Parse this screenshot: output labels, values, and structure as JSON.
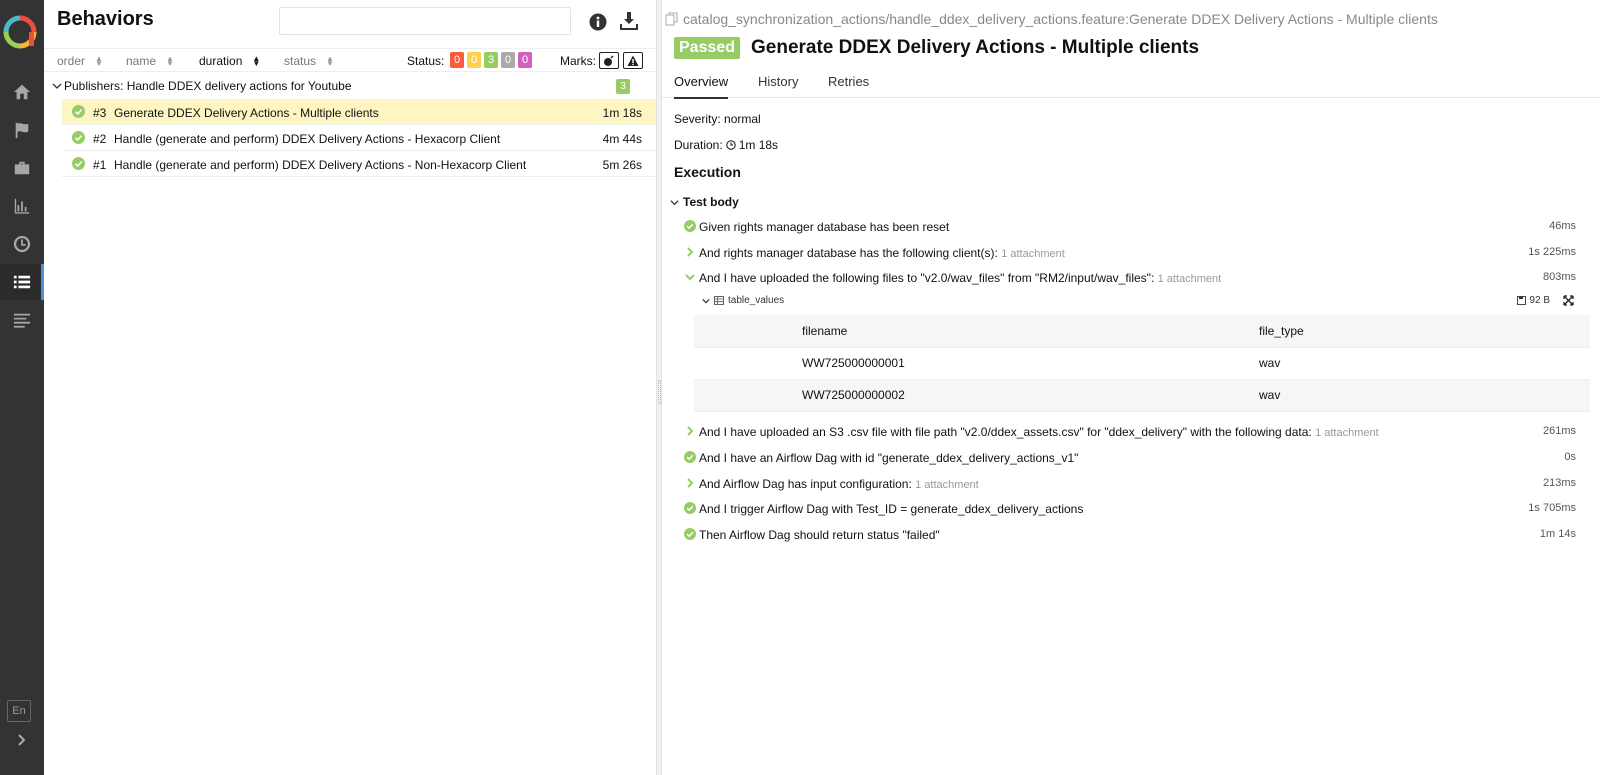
{
  "sidebar": {
    "language": "En",
    "items": [
      {
        "name": "home-icon"
      },
      {
        "name": "flag-icon"
      },
      {
        "name": "briefcase-icon"
      },
      {
        "name": "bar-chart-icon"
      },
      {
        "name": "clock-icon"
      },
      {
        "name": "list-icon",
        "active": true
      },
      {
        "name": "timeline-icon"
      }
    ]
  },
  "left": {
    "title": "Behaviors",
    "search": {
      "value": "",
      "placeholder": ""
    },
    "sort": {
      "order": "order",
      "name": "name",
      "duration": "duration",
      "status": "status"
    },
    "status_label": "Status:",
    "status_counts": [
      {
        "value": "0",
        "color": "#fd5a3e"
      },
      {
        "value": "0",
        "color": "#ffd050"
      },
      {
        "value": "3",
        "color": "#97cc64"
      },
      {
        "value": "0",
        "color": "#aaaaaa"
      },
      {
        "value": "0",
        "color": "#d35ebe"
      }
    ],
    "marks_label": "Marks:",
    "group": {
      "label": "Publishers: Handle DDEX delivery actions for Youtube",
      "count": "3"
    },
    "tests": [
      {
        "num": "#3",
        "name": "Generate DDEX Delivery Actions - Multiple clients",
        "duration": "1m 18s",
        "selected": true
      },
      {
        "num": "#2",
        "name": "Handle (generate and perform) DDEX Delivery Actions - Hexacorp Client",
        "duration": "4m 44s"
      },
      {
        "num": "#1",
        "name": "Handle (generate and perform) DDEX Delivery Actions - Non-Hexacorp Client",
        "duration": "5m 26s"
      }
    ]
  },
  "right": {
    "breadcrumb": "catalog_synchronization_actions/handle_ddex_delivery_actions.feature:Generate DDEX Delivery Actions - Multiple clients",
    "status": "Passed",
    "title": "Generate DDEX Delivery Actions - Multiple clients",
    "tabs": [
      "Overview",
      "History",
      "Retries"
    ],
    "severity": "Severity: normal",
    "duration_label": "Duration:",
    "duration_value": "1m 18s",
    "execution_title": "Execution",
    "test_body": "Test body",
    "steps": [
      {
        "text": "Given rights manager database has been reset",
        "attachment": "",
        "duration": "46ms"
      },
      {
        "text": "And rights manager database has the following client(s):",
        "attachment": "1 attachment",
        "duration": "1s 225ms"
      },
      {
        "text": "And I have uploaded the following files to \"v2.0/wav_files\" from \"RM2/input/wav_files\":",
        "attachment": "1 attachment",
        "duration": "803ms"
      },
      {
        "text": "And I have uploaded an S3 .csv file with file path \"v2.0/ddex_assets.csv\" for \"ddex_delivery\" with the following data:",
        "attachment": "1 attachment",
        "duration": "261ms"
      },
      {
        "text": "And I have an Airflow Dag with id \"generate_ddex_delivery_actions_v1\"",
        "attachment": "",
        "duration": "0s"
      },
      {
        "text": "And Airflow Dag has input configuration:",
        "attachment": "1 attachment",
        "duration": "213ms"
      },
      {
        "text": "And I trigger Airflow Dag with Test_ID = generate_ddex_delivery_actions",
        "attachment": "",
        "duration": "1s 705ms"
      },
      {
        "text": "Then Airflow Dag should return status \"failed\"",
        "attachment": "",
        "duration": "1m 14s"
      }
    ],
    "attachment": {
      "name": "table_values",
      "size": "92 B",
      "headers": [
        "filename",
        "file_type"
      ],
      "rows": [
        [
          "WW725000000001",
          "wav"
        ],
        [
          "WW725000000002",
          "wav"
        ]
      ]
    }
  }
}
